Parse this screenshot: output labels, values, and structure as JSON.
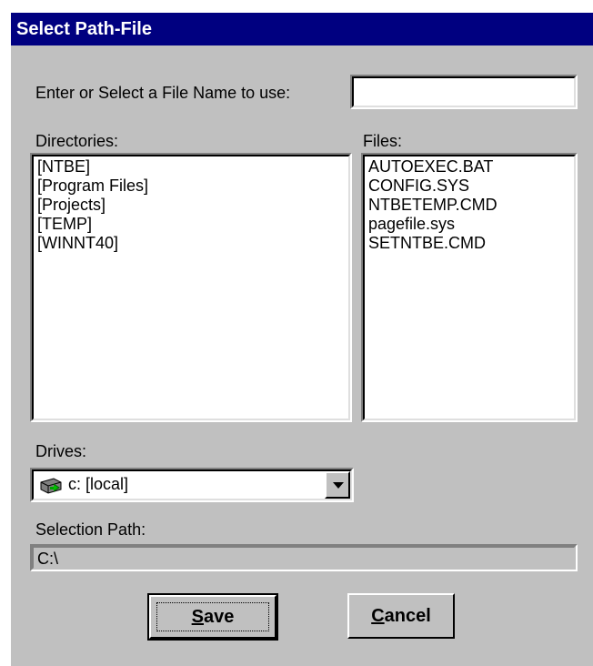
{
  "window": {
    "title": "Select Path-File"
  },
  "filename": {
    "label": "Enter or Select a File Name to use:",
    "value": ""
  },
  "directories": {
    "label": "Directories:",
    "items": [
      "[NTBE]",
      "[Program Files]",
      "[Projects]",
      "[TEMP]",
      "[WINNT40]"
    ]
  },
  "files": {
    "label": "Files:",
    "items": [
      "AUTOEXEC.BAT",
      "CONFIG.SYS",
      "NTBETEMP.CMD",
      "pagefile.sys",
      "SETNTBE.CMD"
    ]
  },
  "drives": {
    "label": "Drives:",
    "selected": "c: [local]",
    "icon": "drive-icon"
  },
  "selection_path": {
    "label": "Selection Path:",
    "value": "C:\\"
  },
  "buttons": {
    "save": {
      "mnemonic": "S",
      "rest": "ave"
    },
    "cancel": {
      "mnemonic": "C",
      "rest": "ancel"
    }
  },
  "colors": {
    "titlebar": "#000080",
    "face": "#c0c0c0"
  }
}
